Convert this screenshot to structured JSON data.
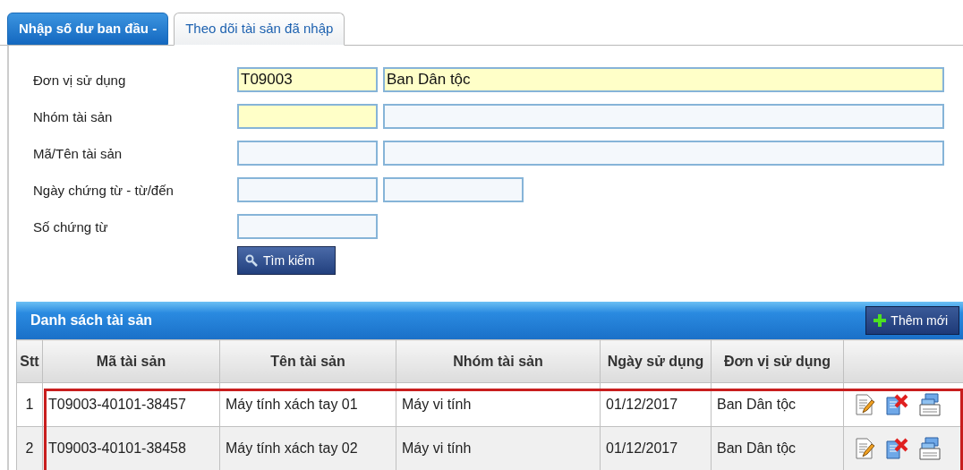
{
  "tabs": [
    {
      "label": "Nhập số dư ban đầu -",
      "selected": false
    },
    {
      "label": "Theo dõi tài sản đã nhập",
      "selected": true
    }
  ],
  "form": {
    "rows": [
      {
        "label": "Đơn vị sử dụng",
        "fields": [
          {
            "value": "T09003",
            "required": true,
            "kind": "short"
          },
          {
            "value": "Ban Dân tộc",
            "required": true,
            "kind": "long"
          }
        ]
      },
      {
        "label": "Nhóm tài sản",
        "fields": [
          {
            "required": true,
            "kind": "short"
          },
          {
            "required": false,
            "kind": "long"
          }
        ]
      },
      {
        "label": "Mã/Tên tài sản",
        "fields": [
          {
            "required": false,
            "kind": "short"
          },
          {
            "required": false,
            "kind": "long"
          }
        ]
      },
      {
        "label": "Ngày chứng từ - từ/đến",
        "fields": [
          {
            "required": false,
            "kind": "short"
          },
          {
            "required": false,
            "kind": "short"
          }
        ]
      },
      {
        "label": "Số chứng từ",
        "fields": [
          {
            "required": false,
            "kind": "short"
          }
        ]
      }
    ],
    "search_button": "Tìm kiếm"
  },
  "table": {
    "title": "Danh sách tài sản",
    "add_button": "Thêm mới",
    "columns": [
      "Stt",
      "Mã tài sản",
      "Tên tài sản",
      "Nhóm tài sản",
      "Ngày sử dụng",
      "Đơn vị sử dụng"
    ],
    "rows": [
      {
        "cells": [
          "1",
          "T09003-40101-38457",
          "Máy tính xách tay 01",
          "Máy vi tính",
          "01/12/2017",
          "Ban Dân tộc"
        ]
      },
      {
        "cells": [
          "2",
          "T09003-40101-38458",
          "Máy tính xách tay 02",
          "Máy vi tính",
          "01/12/2017",
          "Ban Dân tộc"
        ]
      }
    ],
    "highlighted": true
  }
}
